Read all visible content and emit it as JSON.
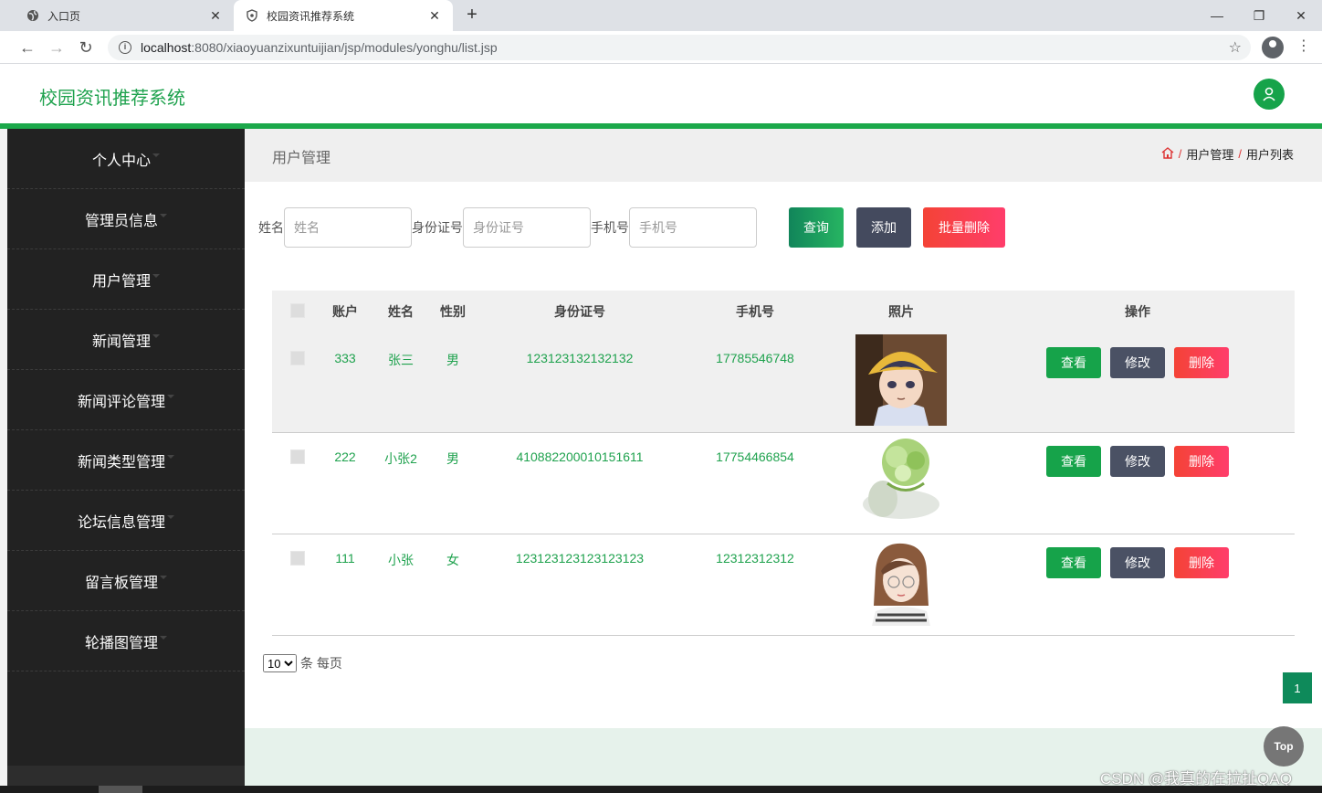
{
  "browser": {
    "tabs": [
      {
        "title": "入口页",
        "active": false
      },
      {
        "title": "校园资讯推荐系统",
        "active": true
      }
    ],
    "url_host": "localhost",
    "url_path": ":8080/xiaoyuanzixuntuijian/jsp/modules/yonghu/list.jsp"
  },
  "header": {
    "app_title": "校园资讯推荐系统"
  },
  "sidebar": {
    "items": [
      {
        "label": "个人中心"
      },
      {
        "label": "管理员信息"
      },
      {
        "label": "用户管理"
      },
      {
        "label": "新闻管理"
      },
      {
        "label": "新闻评论管理"
      },
      {
        "label": "新闻类型管理"
      },
      {
        "label": "论坛信息管理"
      },
      {
        "label": "留言板管理"
      },
      {
        "label": "轮播图管理"
      }
    ]
  },
  "breadcrumb": {
    "title": "用户管理",
    "sep": "/",
    "crumb1": "用户管理",
    "crumb2": "用户列表"
  },
  "search": {
    "name_label": "姓名",
    "name_placeholder": "姓名",
    "id_label": "身份证号",
    "id_placeholder": "身份证号",
    "phone_label": "手机号",
    "phone_placeholder": "手机号",
    "query_label": "查询",
    "add_label": "添加",
    "batch_delete_label": "批量删除"
  },
  "table": {
    "columns": [
      "账户",
      "姓名",
      "性别",
      "身份证号",
      "手机号",
      "照片",
      "操作"
    ],
    "rows": [
      {
        "account": "333",
        "name": "张三",
        "gender": "男",
        "id_number": "123123132132132",
        "phone": "17785546748",
        "photo": "anime-boy-yellow-hat"
      },
      {
        "account": "222",
        "name": "小张2",
        "gender": "男",
        "id_number": "410882200010151611",
        "phone": "17754466854",
        "photo": "cabbage-cat"
      },
      {
        "account": "111",
        "name": "小张",
        "gender": "女",
        "id_number": "123123123123123123",
        "phone": "12312312312",
        "photo": "cartoon-girl-glasses"
      }
    ],
    "actions": {
      "view": "查看",
      "edit": "修改",
      "delete": "删除"
    }
  },
  "pagination": {
    "page_size": "10",
    "page_size_options": [
      "10"
    ],
    "unit_text": "条 每页",
    "current_page": "1"
  },
  "top_button": "Top",
  "watermark": "CSDN @我真的在拉扯QAQ",
  "colors": {
    "brand_green": "#1fa24e",
    "sidebar_bg": "#222222",
    "danger": "#f44336",
    "dark": "#444a5e"
  }
}
